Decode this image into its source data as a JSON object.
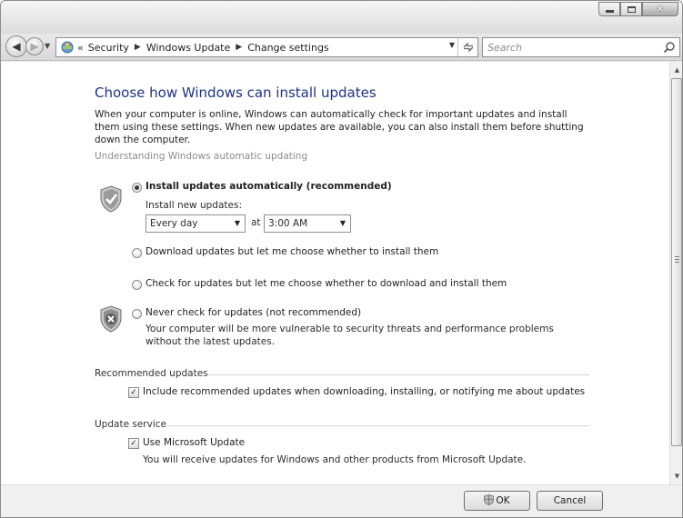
{
  "window": {
    "minimize_glyph": "",
    "maximize_glyph": "",
    "close_glyph": "✕"
  },
  "nav": {
    "breadcrumb_lead": "«",
    "breadcrumbs": [
      "Security",
      "Windows Update",
      "Change settings"
    ],
    "search_placeholder": "Search"
  },
  "content": {
    "heading": "Choose how Windows can install updates",
    "intro": "When your computer is online, Windows can automatically check for important updates and install them using these settings. When new updates are available, you can also install them before shutting down the computer.",
    "help_link": "Understanding Windows automatic updating",
    "options": {
      "auto": "Install updates automatically (recommended)",
      "install_new_label": "Install new updates:",
      "day_value": "Every day",
      "at_label": "at",
      "time_value": "3:00 AM",
      "download": "Download updates but let me choose whether to install them",
      "check": "Check for updates but let me choose whether to download and install them",
      "never": "Never check for updates (not recommended)",
      "never_desc": "Your computer will be more vulnerable to security threats and performance problems without the latest updates."
    },
    "recommended": {
      "title": "Recommended updates",
      "checkbox_label": "Include recommended updates when downloading, installing, or notifying me about updates",
      "checked": true
    },
    "service": {
      "title": "Update service",
      "checkbox_label": "Use Microsoft Update",
      "checked": true,
      "description": "You will receive updates for Windows and other products from Microsoft Update."
    }
  },
  "footer": {
    "ok_label": "OK",
    "cancel_label": "Cancel"
  },
  "icons": {
    "shield_ok": "shield-check-icon",
    "shield_no": "shield-x-icon",
    "check_mark": "✓"
  },
  "colors": {
    "heading": "#1e3287",
    "link": "#8c8c8c"
  }
}
